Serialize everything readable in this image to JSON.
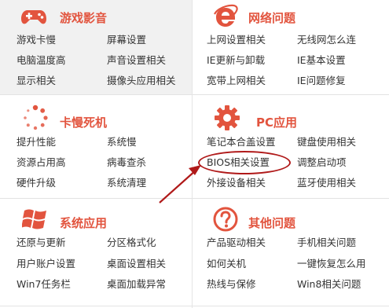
{
  "sections": {
    "games": {
      "title": "游戏影音",
      "icon": "gamepad-icon",
      "links": [
        "游戏卡慢",
        "屏幕设置",
        "电脑温度高",
        "声音设置相关",
        "显示相关",
        "摄像头应用相关"
      ]
    },
    "network": {
      "title": "网络问题",
      "icon": "ie-browser-icon",
      "links": [
        "上网设置相关",
        "无线网怎么连",
        "IE更新与卸载",
        "IE基本设置",
        "宽带上网相关",
        "IE问题修复"
      ]
    },
    "slow": {
      "title": "卡慢死机",
      "icon": "loading-spinner-icon",
      "links": [
        "提升性能",
        "系统慢",
        "资源占用高",
        "病毒查杀",
        "硬件升级",
        "系统清理"
      ]
    },
    "pc": {
      "title": "PC应用",
      "icon": "gear-icon",
      "links": [
        "笔记本合盖设置",
        "键盘使用相关",
        "BIOS相关设置",
        "调整启动项",
        "外接设备相关",
        "蓝牙使用相关"
      ]
    },
    "system": {
      "title": "系统应用",
      "icon": "windows-logo-icon",
      "links": [
        "还原与更新",
        "分区格式化",
        "用户账户设置",
        "桌面设置相关",
        "Win7任务栏",
        "桌面加载异常"
      ]
    },
    "other": {
      "title": "其他问题",
      "icon": "question-mark-icon",
      "links": [
        "产品驱动相关",
        "手机相关问题",
        "如何关机",
        "一键恢复怎么用",
        "热线与保修",
        "Win8相关问题"
      ]
    }
  },
  "highlight": {
    "target": "BIOS相关设置",
    "color": "#b01919"
  },
  "colors": {
    "accent": "#e2543e",
    "highlight_ring": "#b01919",
    "panel_gray": "#f1f1f1"
  }
}
